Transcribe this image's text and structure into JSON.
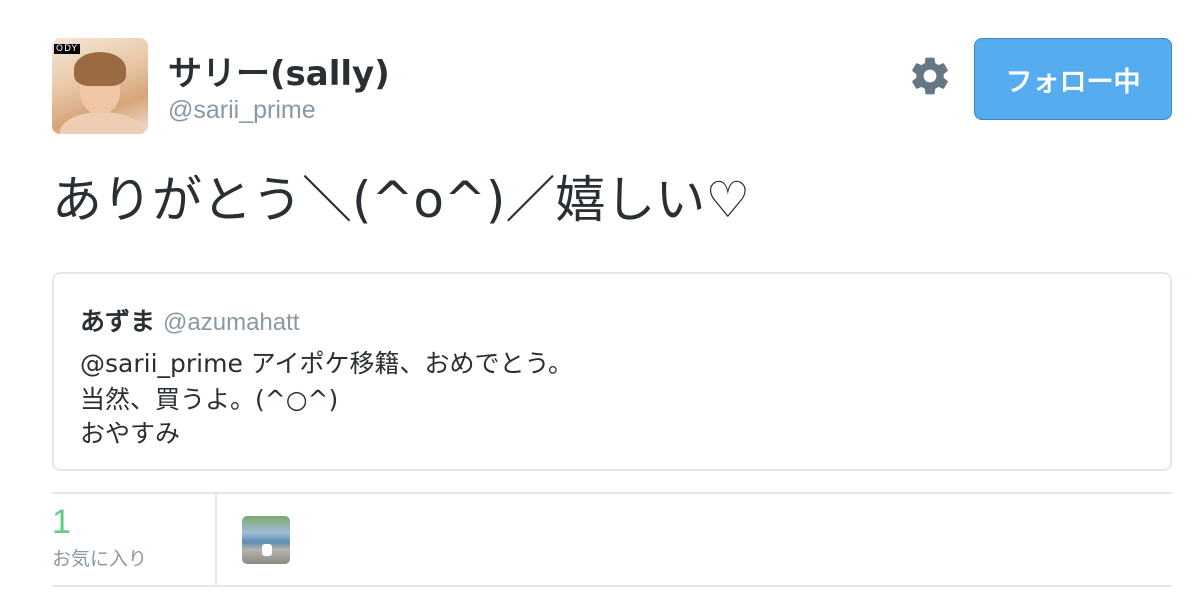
{
  "tweet": {
    "author": {
      "display_name": "サリー(sally)",
      "screen_name": "@sarii_prime",
      "avatar_tag": "ODY"
    },
    "follow_button_label": "フォロー中",
    "text": "ありがとう＼(^o^)／嬉しい♡",
    "quoted": {
      "name": "あずま",
      "screen_name": "@azumahatt",
      "lines": [
        "@sarii_prime アイポケ移籍、おめでとう。",
        "当然、買うよ。(^○^)",
        "おやすみ"
      ]
    },
    "stats": {
      "favorites_count": "1",
      "favorites_label": "お気に入り"
    }
  },
  "colors": {
    "accent": "#55acee",
    "text": "#292f33",
    "muted": "#8899a6",
    "border": "#e1e8ed",
    "favorite_count": "#5fcc87"
  },
  "icons": {
    "gear": "gear-icon"
  }
}
